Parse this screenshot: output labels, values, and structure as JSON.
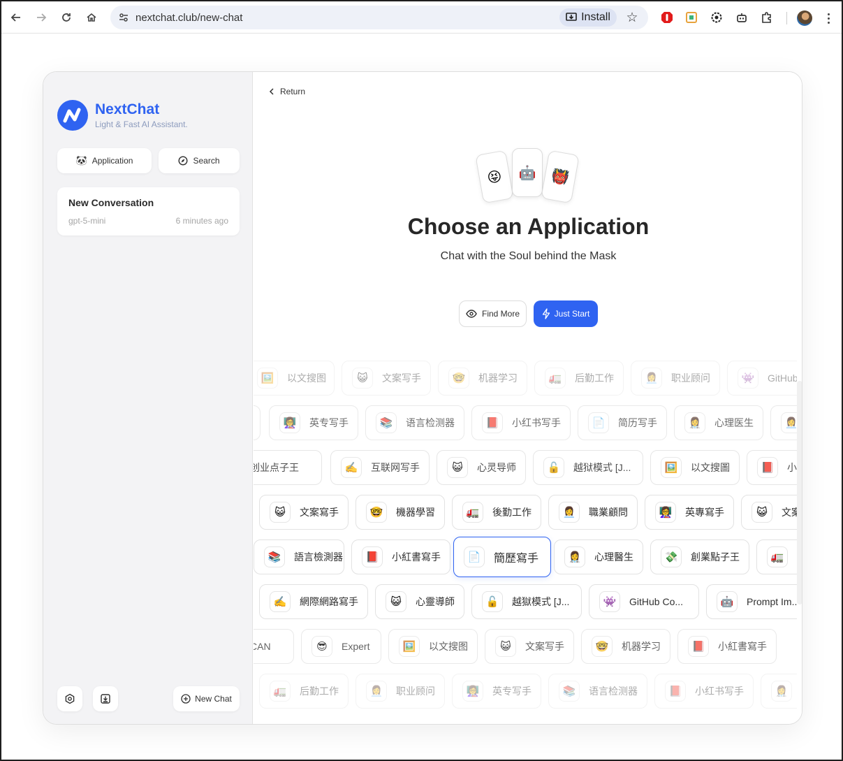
{
  "browser": {
    "url": "nextchat.club/new-chat",
    "install_label": "Install"
  },
  "sidebar": {
    "brand": "NextChat",
    "tagline": "Light & Fast AI Assistant.",
    "application_label": "Application",
    "search_label": "Search",
    "conversation": {
      "title": "New Conversation",
      "model": "gpt-5-mini",
      "time": "6 minutes ago"
    },
    "new_chat_label": "New Chat"
  },
  "main": {
    "return_label": "Return",
    "card_emojis": [
      "😝",
      "🤖",
      "👹"
    ],
    "headline": "Choose an Application",
    "subline": "Chat with the Soul behind the Mask",
    "find_more_label": "Find More",
    "just_start_label": "Just Start"
  },
  "masks": {
    "rows": [
      {
        "opacity": 0.4,
        "items": [
          {
            "emoji": "🖼️",
            "label": "以文搜图"
          },
          {
            "emoji": "😺",
            "label": "文案写手"
          },
          {
            "emoji": "🤓",
            "label": "机器学习"
          },
          {
            "emoji": "🚛",
            "label": "后勤工作"
          },
          {
            "emoji": "👩‍💼",
            "label": "职业顾问"
          },
          {
            "emoji": "👾",
            "label": "GitHub"
          }
        ]
      },
      {
        "opacity": 0.7,
        "items": [
          {
            "emoji": "",
            "label": ""
          },
          {
            "emoji": "👩‍🏫",
            "label": "英专写手"
          },
          {
            "emoji": "📚",
            "label": "语言检测器"
          },
          {
            "emoji": "📕",
            "label": "小红书写手"
          },
          {
            "emoji": "📄",
            "label": "简历写手"
          },
          {
            "emoji": "👩‍⚕️",
            "label": "心理医生"
          },
          {
            "emoji": "👩‍💼",
            "label": ""
          }
        ]
      },
      {
        "opacity": 0.85,
        "items": [
          {
            "emoji": "",
            "label": "创业点子王"
          },
          {
            "emoji": "✍️",
            "label": "互联网写手"
          },
          {
            "emoji": "😺",
            "label": "心灵导师"
          },
          {
            "emoji": "🔓",
            "label": "越狱模式 [J..."
          },
          {
            "emoji": "🖼️",
            "label": "以文搜圖"
          },
          {
            "emoji": "📕",
            "label": "小"
          }
        ]
      },
      {
        "opacity": 1,
        "items": [
          {
            "emoji": "😺",
            "label": "文案寫手"
          },
          {
            "emoji": "🤓",
            "label": "機器學習"
          },
          {
            "emoji": "🚛",
            "label": "後勤工作"
          },
          {
            "emoji": "👩‍💼",
            "label": "職業顧問"
          },
          {
            "emoji": "👩‍🏫",
            "label": "英專寫手"
          },
          {
            "emoji": "😺",
            "label": "文案"
          }
        ]
      },
      {
        "opacity": 1,
        "items": [
          {
            "emoji": "📚",
            "label": "語言檢測器"
          },
          {
            "emoji": "📕",
            "label": "小紅書寫手"
          },
          {
            "emoji": "📄",
            "label": "簡歷寫手"
          },
          {
            "emoji": "👩‍⚕️",
            "label": "心理醫生"
          },
          {
            "emoji": "💸",
            "label": "創業點子王"
          },
          {
            "emoji": "🚛",
            "label": ""
          }
        ]
      },
      {
        "opacity": 1,
        "items": [
          {
            "emoji": "✍️",
            "label": "網際網路寫手"
          },
          {
            "emoji": "😺",
            "label": "心靈導師"
          },
          {
            "emoji": "🔓",
            "label": "越獄模式 [J..."
          },
          {
            "emoji": "👾",
            "label": "GitHub Co..."
          },
          {
            "emoji": "🤖",
            "label": "Prompt Im..."
          }
        ]
      },
      {
        "opacity": 0.75,
        "items": [
          {
            "emoji": "",
            "label": "CAN"
          },
          {
            "emoji": "😎",
            "label": "Expert"
          },
          {
            "emoji": "🖼️",
            "label": "以文搜图"
          },
          {
            "emoji": "😺",
            "label": "文案写手"
          },
          {
            "emoji": "🤓",
            "label": "机器学习"
          },
          {
            "emoji": "📕",
            "label": "小紅書寫手"
          }
        ]
      },
      {
        "opacity": 0.4,
        "items": [
          {
            "emoji": "🚛",
            "label": "后勤工作"
          },
          {
            "emoji": "👩‍💼",
            "label": "职业顾问"
          },
          {
            "emoji": "👩‍🏫",
            "label": "英专写手"
          },
          {
            "emoji": "📚",
            "label": "语言检测器"
          },
          {
            "emoji": "📕",
            "label": "小红书写手"
          },
          {
            "emoji": "👩‍⚕️",
            "label": ""
          }
        ]
      }
    ]
  }
}
